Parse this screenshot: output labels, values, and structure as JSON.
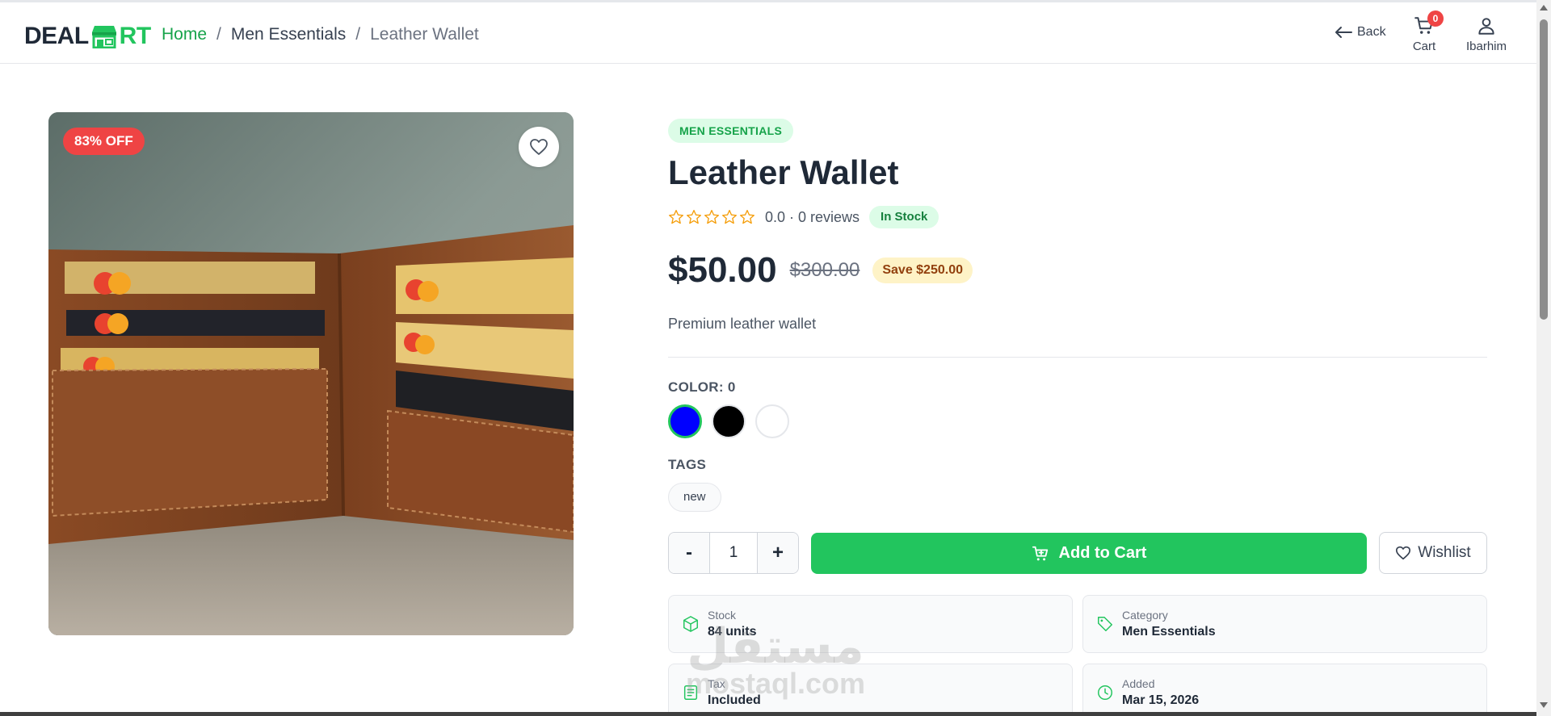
{
  "header": {
    "logo": {
      "part1": "DEAL",
      "part2": "RT"
    },
    "breadcrumb": [
      "Home",
      "Men Essentials",
      "Leather Wallet"
    ],
    "separator": "/",
    "back_label": "Back",
    "cart_label": "Cart",
    "cart_count": "0",
    "user_label": "Ibarhim"
  },
  "product": {
    "discount_badge": "83% OFF",
    "category": "MEN ESSENTIALS",
    "title": "Leather Wallet",
    "rating_text": "0.0 · 0 reviews",
    "rating_value": 0,
    "rating_max": 5,
    "stock_status": "In Stock",
    "price": "$50.00",
    "old_price": "$300.00",
    "save_label": "Save $250.00",
    "description": "Premium leather wallet",
    "color_label": "COLOR: 0",
    "colors": [
      "#0000ff",
      "#000000",
      "#ffffff"
    ],
    "tags_label": "TAGS",
    "tags": [
      "new"
    ],
    "quantity": "1",
    "qty_minus": "-",
    "qty_plus": "+",
    "add_to_cart": "Add to Cart",
    "wishlist": "Wishlist"
  },
  "info": {
    "stock": {
      "label": "Stock",
      "value": "84 units"
    },
    "category": {
      "label": "Category",
      "value": "Men Essentials"
    },
    "tax": {
      "label": "Tax",
      "value": "Included"
    },
    "added": {
      "label": "Added",
      "value": "Mar 15, 2026"
    }
  },
  "watermark": {
    "line1": "مستقل",
    "line2": "mostaql.com"
  },
  "colors": {
    "accent": "#22c55e",
    "badge": "#ef4444",
    "text": "#1f2937"
  }
}
